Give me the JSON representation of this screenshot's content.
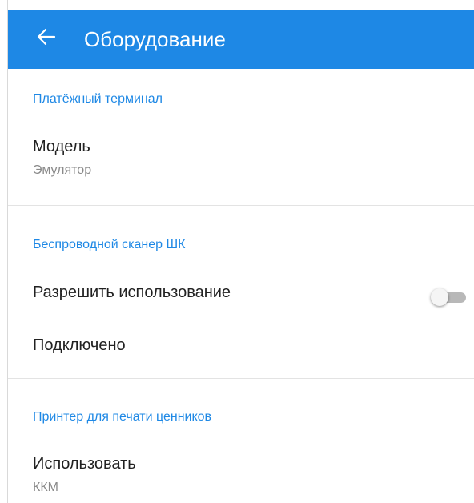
{
  "colors": {
    "appbar_background": "#1e88e5",
    "section_header": "#1e88e5",
    "primary_text": "#212121",
    "secondary_text": "#8a8a8a"
  },
  "appbar": {
    "back_icon": "arrow-left-icon",
    "title": "Оборудование"
  },
  "sections": {
    "payment_terminal": {
      "header": "Платёжный терминал",
      "model": {
        "title": "Модель",
        "summary": "Эмулятор"
      }
    },
    "wireless_scanner": {
      "header": "Беспроводной сканер ШК",
      "allow_usage": {
        "title": "Разрешить использование",
        "switch_on": false
      },
      "connected": {
        "title": "Подключено"
      }
    },
    "price_tag_printer": {
      "header": "Принтер для печати ценников",
      "use": {
        "title": "Использовать",
        "summary": "ККМ"
      }
    }
  }
}
